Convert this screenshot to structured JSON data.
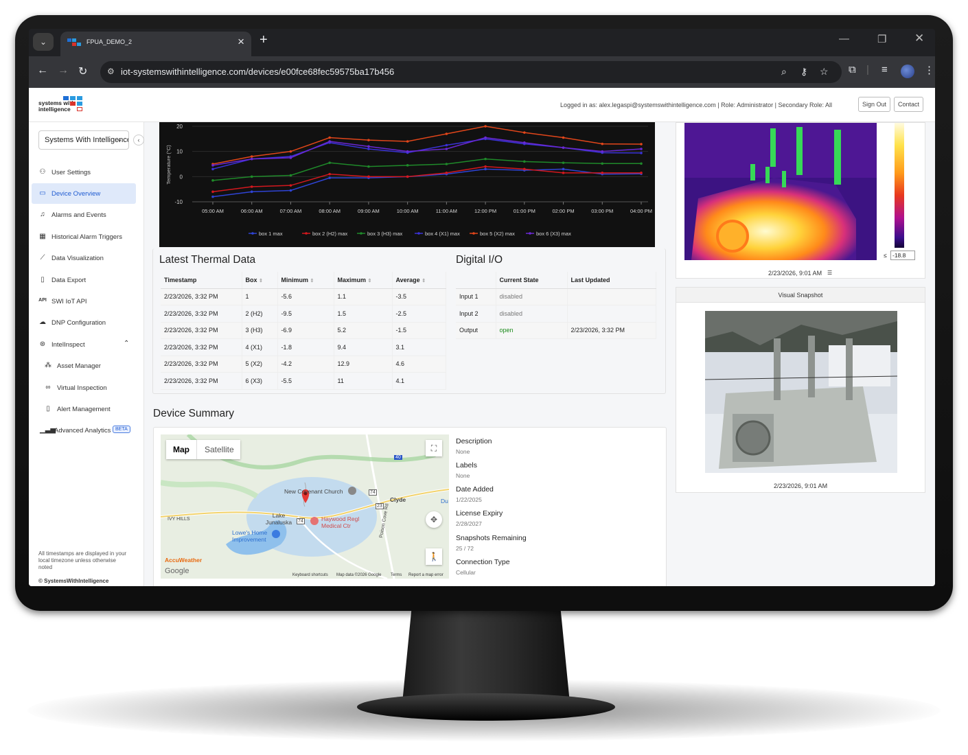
{
  "browser": {
    "tab_title": "FPUA_DEMO_2",
    "url": "iot-systemswithintelligence.com/devices/e00fce68fec59575ba17b456"
  },
  "header": {
    "logo_line1": "systems with",
    "logo_line2": "intelligence",
    "login_info": "Logged in as: alex.legaspi@systemswithintelligence.com  |  Role: Administrator  |  Secondary Role: All",
    "sign_out": "Sign Out",
    "contact": "Contact"
  },
  "sidebar": {
    "org": "Systems With Intelligence",
    "items": [
      {
        "label": "User Settings",
        "icon": "user-gear-icon"
      },
      {
        "label": "Device Overview",
        "icon": "device-icon",
        "active": true
      },
      {
        "label": "Alarms and Events",
        "icon": "bell-icon"
      },
      {
        "label": "Historical Alarm Triggers",
        "icon": "calendar-icon"
      },
      {
        "label": "Data Visualization",
        "icon": "line-chart-icon"
      },
      {
        "label": "Data Export",
        "icon": "file-icon"
      },
      {
        "label": "SWI IoT API",
        "icon": "api-icon"
      },
      {
        "label": "DNP Configuration",
        "icon": "cloud-icon"
      },
      {
        "label": "IntelInspect",
        "icon": "inspect-icon"
      },
      {
        "label": "Asset Manager",
        "icon": "nodes-icon"
      },
      {
        "label": "Virtual Inspection",
        "icon": "binoculars-icon"
      },
      {
        "label": "Alert Management",
        "icon": "file-alert-icon"
      },
      {
        "label": "Advanced Analytics",
        "icon": "bar-chart-icon"
      }
    ],
    "beta": "BETA",
    "note": "All timestamps are displayed in your local timezone unless otherwise noted",
    "copyright": "© SystemsWithIntelligence"
  },
  "chart_data": {
    "type": "line",
    "ylabel": "Temperature (°C)",
    "xlabel": "",
    "ylim": [
      -10,
      20
    ],
    "yticks": [
      "20",
      "10",
      "0",
      "-10"
    ],
    "categories": [
      "05:00 AM",
      "06:00 AM",
      "07:00 AM",
      "08:00 AM",
      "09:00 AM",
      "10:00 AM",
      "11:00 AM",
      "12:00 PM",
      "01:00 PM",
      "02:00 PM",
      "03:00 PM",
      "04:00 PM"
    ],
    "series": [
      {
        "name": "box 1 max",
        "color": "#2f44d6",
        "values": [
          -8,
          -6,
          -5.5,
          -0.5,
          -0.5,
          0,
          1,
          3,
          2.5,
          3,
          1,
          1.1
        ]
      },
      {
        "name": "box 2 (H2) max",
        "color": "#d4181e",
        "values": [
          -6,
          -4,
          -3.5,
          1,
          0,
          0,
          1.5,
          4,
          3,
          1.5,
          1.5,
          1.5
        ]
      },
      {
        "name": "box 3 (H3) max",
        "color": "#1f8a2a",
        "values": [
          -1.5,
          0,
          0.5,
          5.5,
          4,
          4.5,
          5,
          7,
          6,
          5.5,
          5.2,
          5.2
        ]
      },
      {
        "name": "box 4 (X1) max",
        "color": "#3a32d8",
        "values": [
          3,
          7,
          8,
          13.5,
          11,
          9.5,
          12.5,
          15,
          13,
          11.5,
          9.5,
          9.4
        ]
      },
      {
        "name": "box 5 (X2) max",
        "color": "#e2461a",
        "values": [
          5,
          8,
          10,
          15.5,
          14.5,
          14,
          17,
          20,
          17.5,
          15.5,
          13,
          12.9
        ]
      },
      {
        "name": "box 6 (X3) max",
        "color": "#6a28d4",
        "values": [
          4.5,
          7,
          7.5,
          14,
          12,
          10,
          11,
          15.5,
          13.5,
          11.5,
          10,
          11
        ]
      }
    ],
    "legend": "bottom"
  },
  "thermal": {
    "title": "Latest Thermal Data",
    "columns": [
      "Timestamp",
      "Box",
      "Minimum",
      "Maximum",
      "Average"
    ],
    "rows": [
      [
        "2/23/2026, 3:32 PM",
        "1",
        "-5.6",
        "1.1",
        "-3.5"
      ],
      [
        "2/23/2026, 3:32 PM",
        "2 (H2)",
        "-9.5",
        "1.5",
        "-2.5"
      ],
      [
        "2/23/2026, 3:32 PM",
        "3 (H3)",
        "-6.9",
        "5.2",
        "-1.5"
      ],
      [
        "2/23/2026, 3:32 PM",
        "4 (X1)",
        "-1.8",
        "9.4",
        "3.1"
      ],
      [
        "2/23/2026, 3:32 PM",
        "5 (X2)",
        "-4.2",
        "12.9",
        "4.6"
      ],
      [
        "2/23/2026, 3:32 PM",
        "6 (X3)",
        "-5.5",
        "11",
        "4.1"
      ]
    ]
  },
  "digital": {
    "title": "Digital I/O",
    "columns": [
      "",
      "Current State",
      "Last Updated"
    ],
    "rows": [
      [
        "Input 1",
        "disabled",
        ""
      ],
      [
        "Input 2",
        "disabled",
        ""
      ],
      [
        "Output",
        "open",
        "2/23/2026, 3:32 PM"
      ]
    ]
  },
  "summary": {
    "title": "Device Summary",
    "map": {
      "map_btn": "Map",
      "satellite_btn": "Satellite",
      "labels": [
        "New Covenant Church",
        "Clyde",
        "Lake Junaluska",
        "IVY HILLS",
        "Lowe's Home Improvement",
        "Haywood Regl Medical Ctr",
        "74",
        "23",
        "40",
        "74",
        "Du",
        "Poison Cove Rd"
      ],
      "accuweather": "AccuWeather",
      "google": "Google",
      "footer": [
        "Keyboard shortcuts",
        "Map data ©2026 Google",
        "Terms",
        "Report a map error"
      ]
    },
    "fields": [
      {
        "label": "Description",
        "value": "None"
      },
      {
        "label": "Labels",
        "value": "None"
      },
      {
        "label": "Date Added",
        "value": "1/22/2025"
      },
      {
        "label": "License Expiry",
        "value": "2/28/2027"
      },
      {
        "label": "Snapshots Remaining",
        "value": "25 / 72"
      },
      {
        "label": "Connection Type",
        "value": "Cellular"
      }
    ]
  },
  "thermal_image": {
    "scale_min_symbol": "≤",
    "scale_min": "-18.8",
    "timestamp": "2/23/2026, 9:01 AM"
  },
  "visual": {
    "title": "Visual Snapshot",
    "timestamp": "2/23/2026, 9:01 AM"
  }
}
